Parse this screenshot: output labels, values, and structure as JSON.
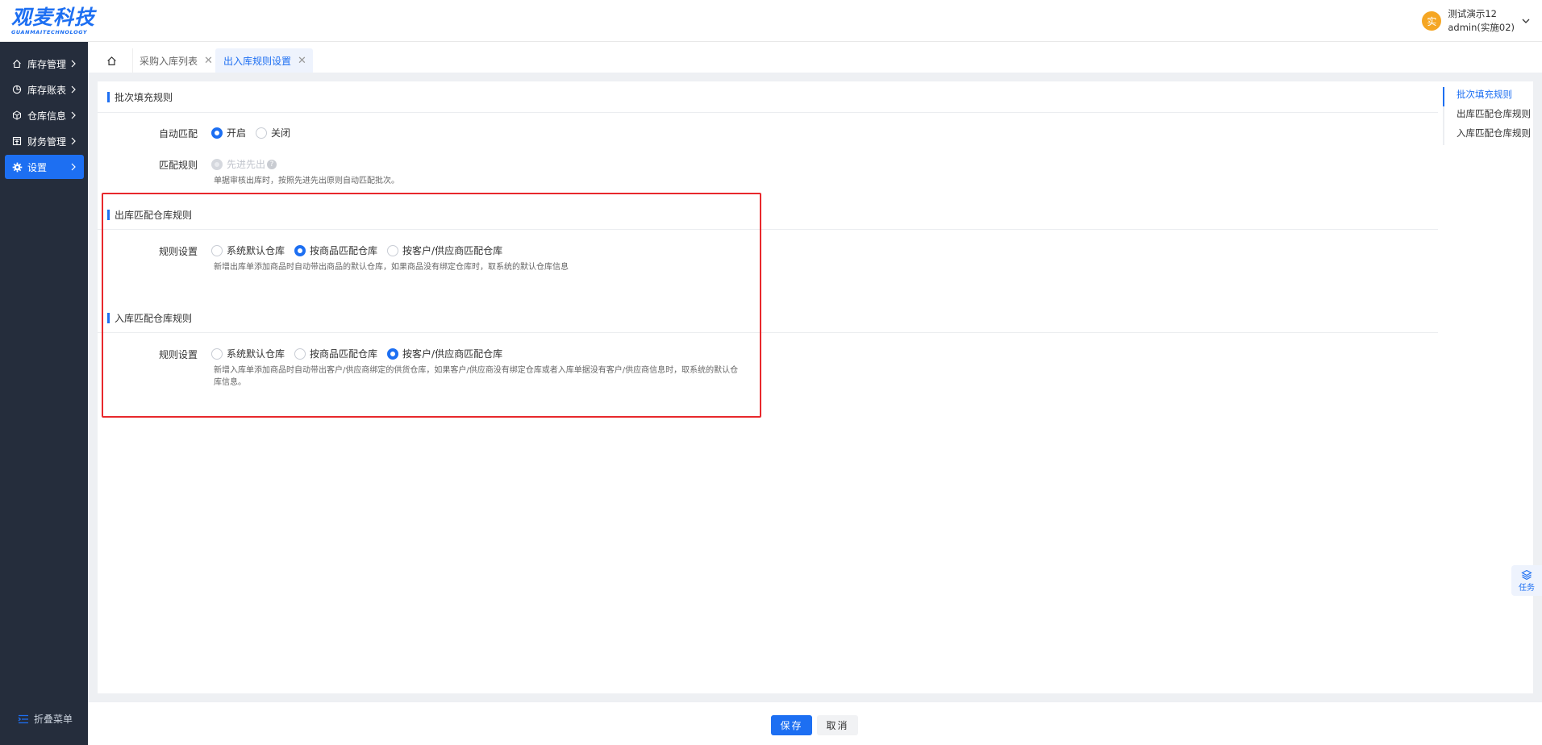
{
  "header": {
    "logo_cn": "观麦科技",
    "logo_en": "GUANMAITECHNOLOGY",
    "avatar_char": "实",
    "user_name": "测试演示12",
    "user_account": "admin(实施02)"
  },
  "sidebar": {
    "items": [
      {
        "label": "库存管理",
        "icon": "home-icon"
      },
      {
        "label": "库存账表",
        "icon": "chart-icon"
      },
      {
        "label": "仓库信息",
        "icon": "cube-icon"
      },
      {
        "label": "财务管理",
        "icon": "ledger-icon"
      },
      {
        "label": "设置",
        "icon": "gear-icon"
      }
    ],
    "collapse_label": "折叠菜单"
  },
  "tabs": [
    {
      "label": "采购入库列表"
    },
    {
      "label": "出入库规则设置"
    }
  ],
  "sections": {
    "batch": {
      "title": "批次填充规则",
      "auto_match_label": "自动匹配",
      "on_label": "开启",
      "off_label": "关闭",
      "rule_label": "匹配规则",
      "fifo_label": "先进先出",
      "hint": "单据审核出库时，按照先进先出原则自动匹配批次。"
    },
    "outbound": {
      "title": "出库匹配仓库规则",
      "rule_label": "规则设置",
      "options": [
        "系统默认仓库",
        "按商品匹配仓库",
        "按客户/供应商匹配仓库"
      ],
      "hint": "新增出库单添加商品时自动带出商品的默认仓库，如果商品没有绑定仓库时，取系统的默认仓库信息"
    },
    "inbound": {
      "title": "入库匹配仓库规则",
      "rule_label": "规则设置",
      "options": [
        "系统默认仓库",
        "按商品匹配仓库",
        "按客户/供应商匹配仓库"
      ],
      "hint_line1": "新增入库单添加商品时自动带出客户/供应商绑定的供货仓库，如果客户/供应商没有绑定仓库或者入库单据没有客户/供应商信息时，取系统的默认仓",
      "hint_line2": "库信息。"
    }
  },
  "anchor_nav": [
    "批次填充规则",
    "出库匹配仓库规则",
    "入库匹配仓库规则"
  ],
  "task_label": "任务",
  "footer": {
    "save_label": "保存",
    "cancel_label": "取消"
  },
  "colors": {
    "primary": "#1d6ff2",
    "sidebar_bg": "#252d3c",
    "highlight": "#e8282c"
  }
}
